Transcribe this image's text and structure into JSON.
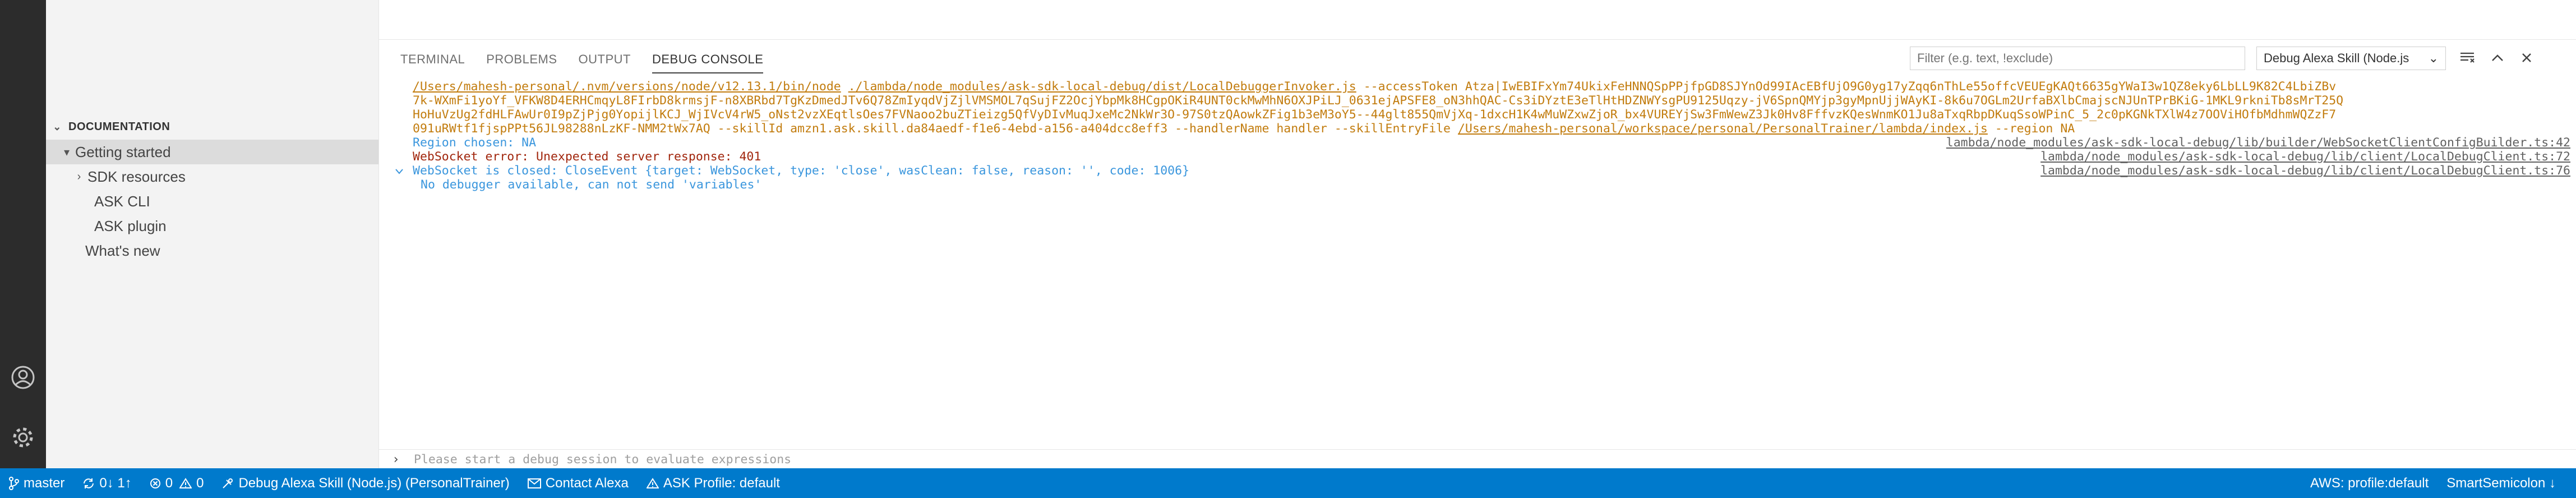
{
  "sidebar": {
    "section_title": "DOCUMENTATION",
    "items": [
      {
        "label": "Getting started",
        "twisty": "▾"
      },
      {
        "label": "SDK resources",
        "twisty": "›"
      },
      {
        "label": "ASK CLI"
      },
      {
        "label": "ASK plugin"
      },
      {
        "label": "What's new"
      }
    ]
  },
  "panel": {
    "tabs": [
      "TERMINAL",
      "PROBLEMS",
      "OUTPUT",
      "DEBUG CONSOLE"
    ],
    "active_tab": "DEBUG CONSOLE",
    "filter_placeholder": "Filter (e.g. text, !exclude)",
    "debug_config": "Debug Alexa Skill (Node.js",
    "console": {
      "cmd_line1_path1": "/Users/mahesh-personal/.nvm/versions/node/v12.13.1/bin/node",
      "cmd_line1_path2": "./lambda/node_modules/ask-sdk-local-debug/dist/LocalDebuggerInvoker.js",
      "cmd_line1_rest": " --accessToken Atza|IwEBIFxYm74UkixFeHNNQSpPPjfpGD8SJYnOd99IAcEBfUjO9G0yg17yZqq6nThLe55offcVEUEgKAQt6635gYWaI3w1QZ8eky6LbLL9K82C4LbiZBv",
      "cmd_line2": "7k-WXmFi1yoYf_VFKW8D4ERHCmqyL8FIrbD8krmsjF-n8XBRbd7TgKzDmedJTv6Q78ZmIyqdVjZjlVMSMOL7qSujFZ2OcjYbpMk8HCgpOKiR4UNT0ckMwMhN6OXJPiLJ_0631ejAPSFE8_oN3hhQAC-Cs3iDYztE3eTlHtHDZNWYsgPU9125Uqzy-jV6SpnQMYjp3gyMpnUjjWAyKI-8k6u7OGLm2UrfaBXlbCmajscNJUnTPrBKiG-1MKL9rkniTb8sMrT25Q",
      "cmd_line3": "HoHuVzUg2fdHLFAwUr0I9pZjPjg0YopijlKCJ_WjIVcV4rW5_oNst2vzXEqtlsOes7FVNaoo2buZTieizg5QfVyDIvMuqJxeMc2NkWr3O-97S0tzQAowkZFig1b3eM3oY5--44glt855QmVjXq-1dxcH1K4wMuWZxwZjoR_bx4VUREYjSw3FmWewZ3Jk0Hv8FffvzKQesWnmKO1Ju8aTxqRbpDKuqSsoWPinC_5_2c0pKGNkTXlW4z7OOViHOfbMdhmWQZzF7",
      "cmd_line4_a": "091uRWtf1fjspPPt56JL98288nLzKF-NMM2tWx7AQ --skillId amzn1.ask.skill.da84aedf-f1e6-4ebd-a156-a404dcc8eff3 --handlerName handler --skillEntryFile ",
      "cmd_line4_path": "/Users/mahesh-personal/workspace/personal/PersonalTrainer/lambda/index.js",
      "cmd_line4_b": " --region NA",
      "region_line": "Region chosen: NA",
      "region_src": "lambda/node_modules/ask-sdk-local-debug/lib/builder/WebSocketClientConfigBuilder.ts:42",
      "error_line": "WebSocket error: Unexpected server response: 401",
      "error_src": "lambda/node_modules/ask-sdk-local-debug/lib/client/LocalDebugClient.ts:72",
      "closed_line": "WebSocket is closed: CloseEvent {target: WebSocket, type: 'close', wasClean: false, reason: '', code: 1006}",
      "closed_src": "lambda/node_modules/ask-sdk-local-debug/lib/client/LocalDebugClient.ts:76",
      "no_debugger": "No debugger available, can not send 'variables'"
    },
    "input_placeholder": "Please start a debug session to evaluate expressions"
  },
  "statusbar": {
    "branch": "master",
    "sync": "0↓ 1↑",
    "errors": "0",
    "warnings": "0",
    "debug_session": "Debug Alexa Skill (Node.js) (PersonalTrainer)",
    "contact": "Contact Alexa",
    "ask_profile": "ASK Profile: default",
    "aws_profile": "AWS: profile:default",
    "smart_semicolon": "SmartSemicolon ↓"
  }
}
